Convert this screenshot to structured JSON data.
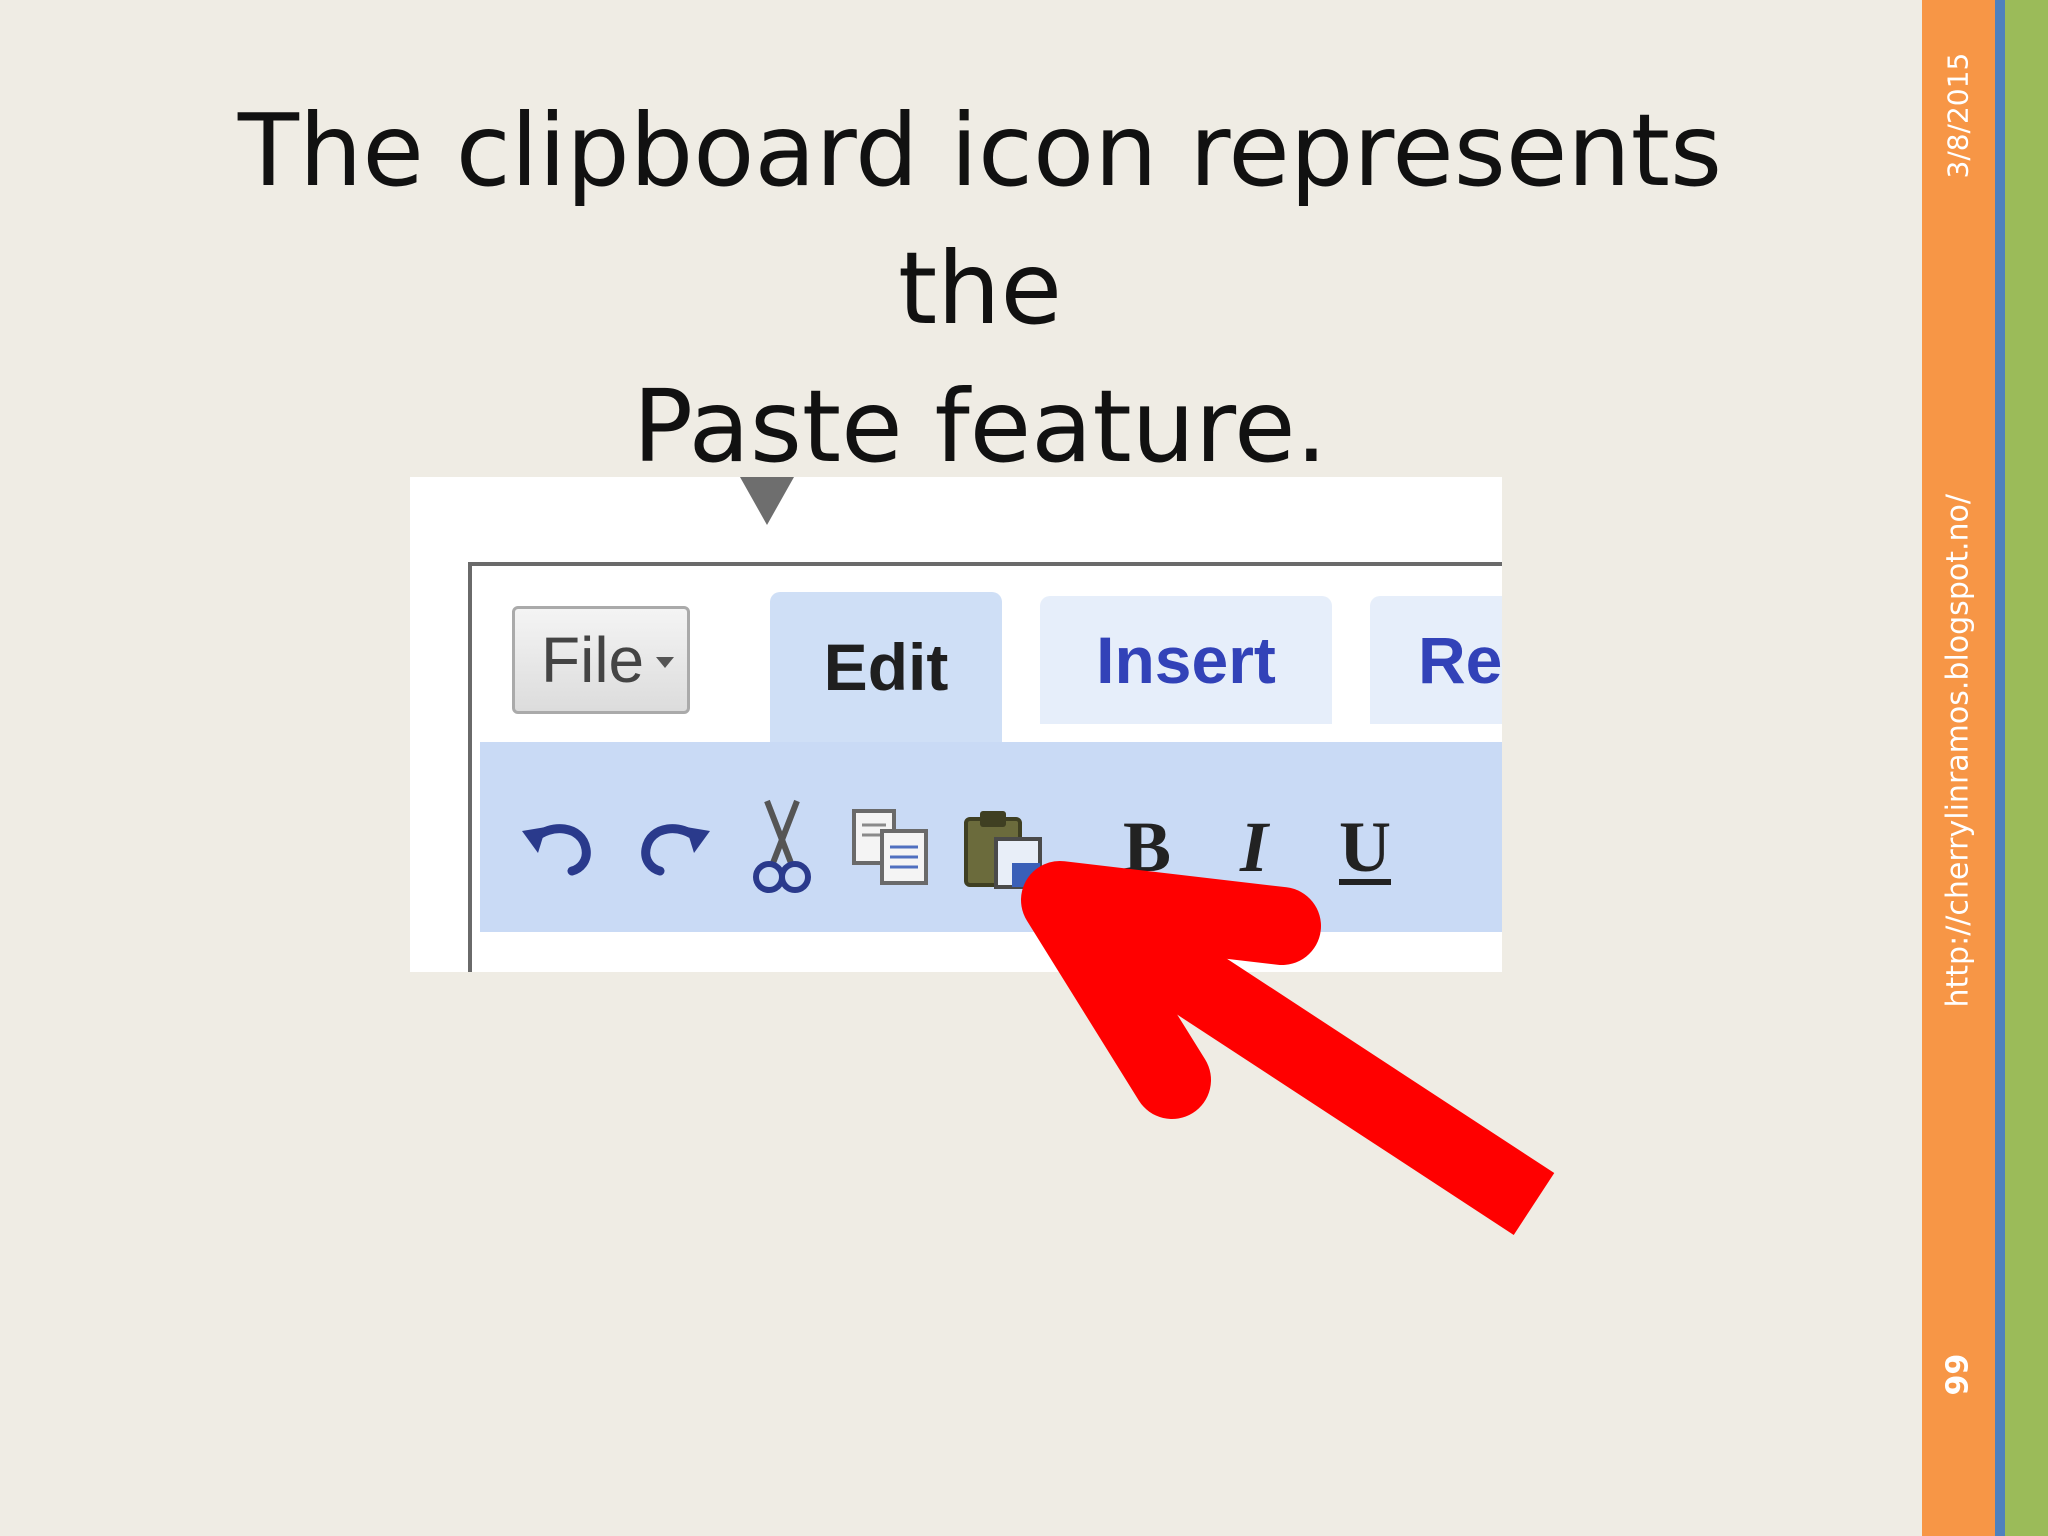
{
  "slide": {
    "title_line1": "The clipboard icon represents the",
    "title_line2": "Paste feature.",
    "date": "3/8/2015",
    "url": "http://cherrylinramos.blogspot.no/",
    "page_number": "99"
  },
  "toolbar": {
    "file_label": "File",
    "tabs": [
      {
        "label": "Edit",
        "active": true
      },
      {
        "label": "Insert",
        "active": false
      },
      {
        "label": "Re",
        "active": false
      }
    ],
    "tools": [
      {
        "name": "undo-icon"
      },
      {
        "name": "redo-icon"
      },
      {
        "name": "cut-icon"
      },
      {
        "name": "copy-icon"
      },
      {
        "name": "paste-icon"
      }
    ],
    "bold_label": "B",
    "italic_label": "I",
    "underline_label": "U"
  },
  "colors": {
    "background": "#efece4",
    "bar_orange": "#f79646",
    "bar_blue": "#4f81bd",
    "bar_green": "#9bbb59",
    "arrow": "#ff0000",
    "ribbon": "#c9daf5",
    "tab_text": "#3242b8"
  }
}
